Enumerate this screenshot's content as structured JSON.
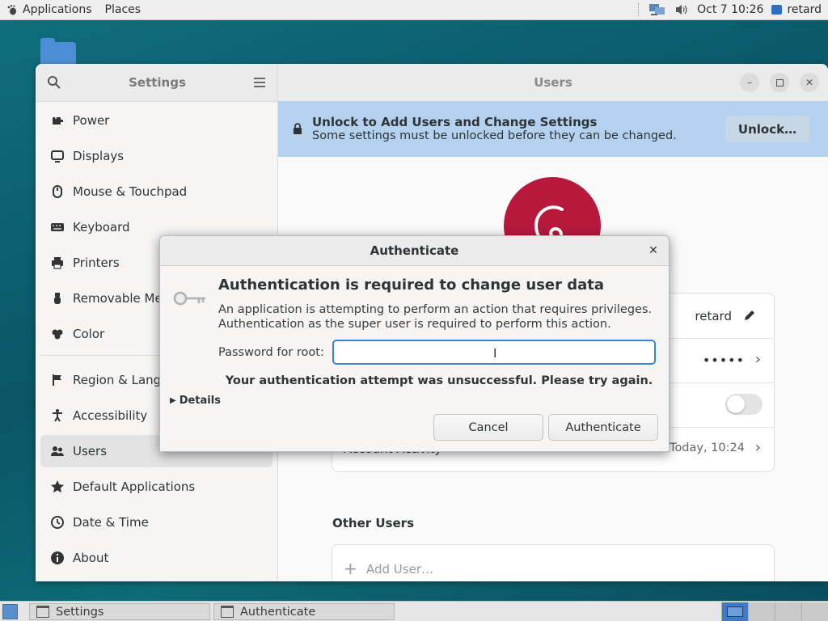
{
  "topbar": {
    "applications": "Applications",
    "places": "Places",
    "datetime": "Oct 7  10:26",
    "user": "retard"
  },
  "settings": {
    "sidebar_title": "Settings",
    "main_title": "Users",
    "sidebar_items": [
      {
        "label": "Power",
        "icon": "power-icon"
      },
      {
        "label": "Displays",
        "icon": "display-icon"
      },
      {
        "label": "Mouse & Touchpad",
        "icon": "mouse-icon"
      },
      {
        "label": "Keyboard",
        "icon": "keyboard-icon"
      },
      {
        "label": "Printers",
        "icon": "printer-icon"
      },
      {
        "label": "Removable Me",
        "icon": "usb-icon"
      },
      {
        "label": "Color",
        "icon": "color-icon"
      },
      {
        "label": "Region & Lang",
        "icon": "flag-icon"
      },
      {
        "label": "Accessibility",
        "icon": "accessibility-icon"
      },
      {
        "label": "Users",
        "icon": "users-icon"
      },
      {
        "label": "Default Applications",
        "icon": "star-icon"
      },
      {
        "label": "Date & Time",
        "icon": "clock-icon"
      },
      {
        "label": "About",
        "icon": "info-icon"
      }
    ],
    "banner": {
      "title": "Unlock to Add Users and Change Settings",
      "subtitle": "Some settings must be unlocked before they can be changed.",
      "unlock_label": "Unlock…"
    },
    "card": {
      "username": "retard",
      "password_dots": "•••••",
      "account_activity_label": "Account Activity",
      "account_activity_value": "Today, 10:24"
    },
    "other_users_title": "Other Users",
    "add_user_label": "Add User…"
  },
  "dialog": {
    "title": "Authenticate",
    "heading": "Authentication is required to change user data",
    "body_line1": "An application is attempting to perform an action that requires privileges.",
    "body_line2": "Authentication as the super user is required to perform this action.",
    "password_label": "Password for root:",
    "password_value": "",
    "error": "Your authentication attempt was unsuccessful. Please try again.",
    "details_label": "Details",
    "cancel_label": "Cancel",
    "authenticate_label": "Authenticate"
  },
  "taskbar": {
    "tasks": [
      "Settings",
      "Authenticate"
    ]
  },
  "colors": {
    "accent": "#3584e4",
    "banner": "#b4d2ef",
    "debian_red": "#b8183c"
  }
}
